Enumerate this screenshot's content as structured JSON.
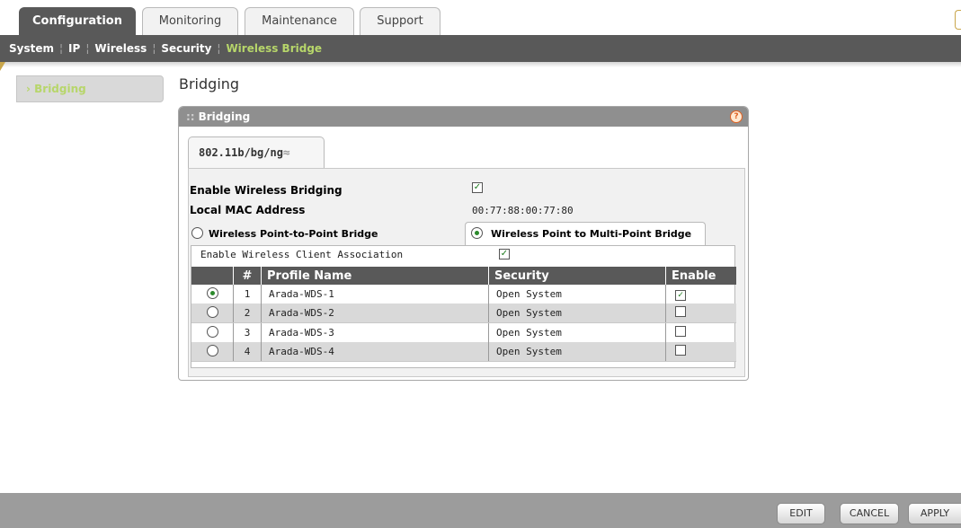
{
  "tabs": [
    {
      "label": "Configuration",
      "active": true
    },
    {
      "label": "Monitoring",
      "active": false
    },
    {
      "label": "Maintenance",
      "active": false
    },
    {
      "label": "Support",
      "active": false
    }
  ],
  "subnav": {
    "items": [
      "System",
      "IP",
      "Wireless",
      "Security",
      "Wireless Bridge"
    ],
    "current": "Wireless Bridge"
  },
  "sidebar": {
    "items": [
      {
        "label": "› Bridging",
        "active": true
      }
    ]
  },
  "page": {
    "title": "Bridging"
  },
  "panel": {
    "header": "Bridging",
    "header_prefix": "::",
    "help_icon": "?",
    "band_tab": "802.11b/bg/ng",
    "enable_bridging": {
      "label": "Enable Wireless Bridging",
      "checked": true
    },
    "local_mac": {
      "label": "Local MAC Address",
      "value": "00:77:88:00:77:80"
    },
    "mode_p2p": {
      "label": "Wireless Point-to-Point Bridge",
      "selected": false
    },
    "mode_p2mp": {
      "label": "Wireless Point to Multi-Point Bridge",
      "selected": true
    },
    "client_assoc": {
      "label": "Enable Wireless Client Association",
      "checked": true
    },
    "table": {
      "headers": [
        "#",
        "Profile Name",
        "Security",
        "Enable"
      ],
      "rows": [
        {
          "num": "1",
          "name": "Arada-WDS-1",
          "security": "Open System",
          "enabled": true,
          "selected": true
        },
        {
          "num": "2",
          "name": "Arada-WDS-2",
          "security": "Open System",
          "enabled": false,
          "selected": false
        },
        {
          "num": "3",
          "name": "Arada-WDS-3",
          "security": "Open System",
          "enabled": false,
          "selected": false
        },
        {
          "num": "4",
          "name": "Arada-WDS-4",
          "security": "Open System",
          "enabled": false,
          "selected": false
        }
      ]
    }
  },
  "buttons": {
    "edit": "EDIT",
    "cancel": "CANCEL",
    "apply": "APPLY"
  },
  "colors": {
    "accent": "#b7d66a",
    "header_bg": "#595959",
    "brand_gold": "#c9a64b"
  },
  "icons": {
    "check": "✓",
    "wifi": "wifi-icon"
  }
}
